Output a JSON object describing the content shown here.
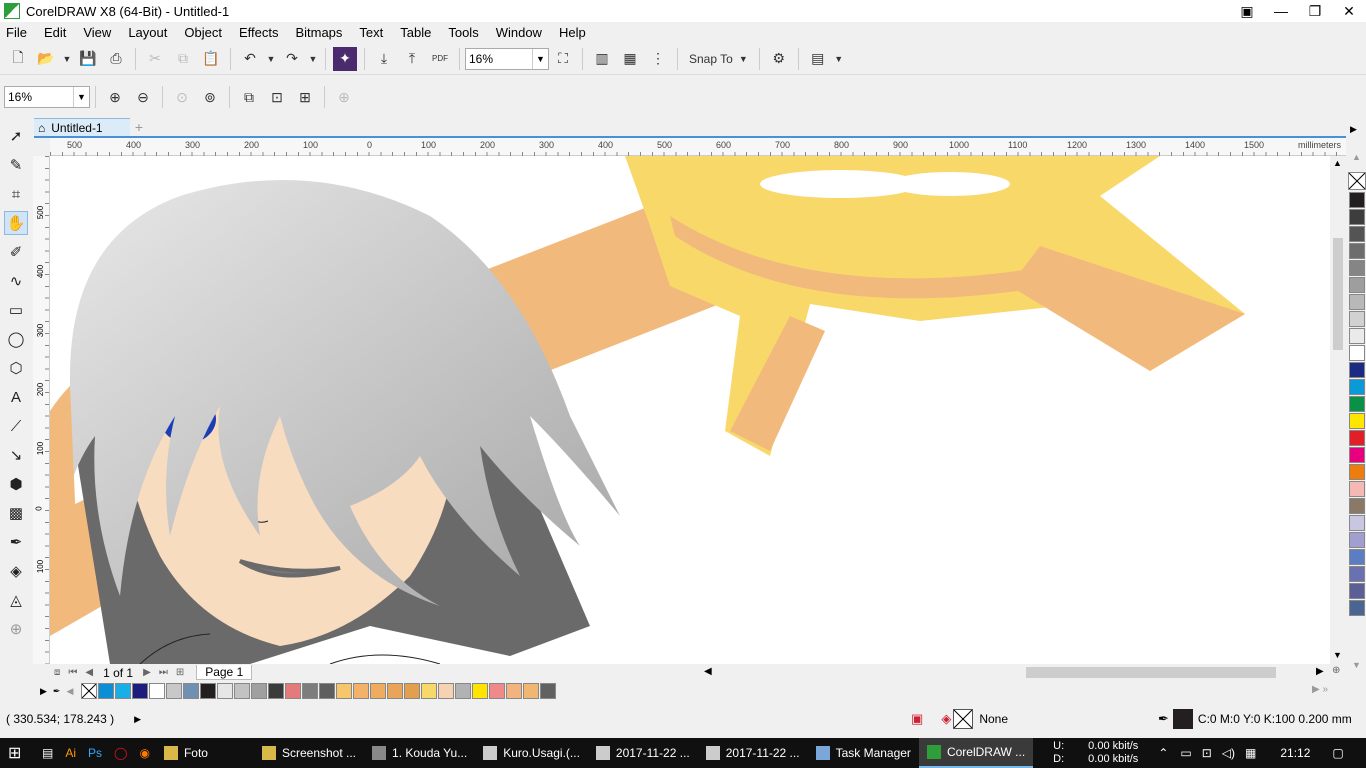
{
  "window": {
    "title": "CorelDRAW X8 (64-Bit) - Untitled-1"
  },
  "menu": [
    {
      "label": "File"
    },
    {
      "label": "Edit"
    },
    {
      "label": "View"
    },
    {
      "label": "Layout"
    },
    {
      "label": "Object"
    },
    {
      "label": "Effects"
    },
    {
      "label": "Bitmaps"
    },
    {
      "label": "Text"
    },
    {
      "label": "Table"
    },
    {
      "label": "Tools"
    },
    {
      "label": "Window"
    },
    {
      "label": "Help"
    }
  ],
  "toolbar": {
    "zoom_value": "16%",
    "snap_label": "Snap To",
    "pdf_label": "PDF"
  },
  "zoombar": {
    "zoom_value": "16%"
  },
  "document": {
    "tab_label": "Untitled-1",
    "page_tab": "Page 1",
    "page_count": "1 of 1"
  },
  "ruler": {
    "units": "millimeters",
    "h_ticks": [
      "500",
      "400",
      "300",
      "200",
      "100",
      "0",
      "100",
      "200",
      "300",
      "400",
      "500",
      "600",
      "700",
      "800",
      "900",
      "1000",
      "1100",
      "1200",
      "1300",
      "1400",
      "1500"
    ],
    "v_ticks": [
      "500",
      "400",
      "300",
      "200",
      "100",
      "0",
      "100"
    ]
  },
  "palette": {
    "horizontal": [
      "#0a8fd6",
      "#19aee6",
      "#1d1d7e",
      "#ffffff",
      "#c8c8c8",
      "#6f8fb3",
      "#231f20",
      "#e6e6e6",
      "#c2c2c2",
      "#a0a0a0",
      "#3b3b3b",
      "#e47a7a",
      "#7d7d7d",
      "#5e5e5e",
      "#f7c56b",
      "#f3b169",
      "#efac5f",
      "#e8a55a",
      "#e2a04e",
      "#f9d86a",
      "#f7d2b2",
      "#b2b2b2",
      "#ffe400",
      "#f08a8a",
      "#f2b37e",
      "#f1b770",
      "#616161"
    ],
    "vertical": [
      "#231f20",
      "#3d3d3d",
      "#545454",
      "#6d6d6d",
      "#858585",
      "#9e9e9e",
      "#b8b8b8",
      "#d1d1d1",
      "#eaeaea",
      "#ffffff",
      "#1c2a84",
      "#0b9ad8",
      "#0a9148",
      "#ffe600",
      "#e41e26",
      "#e6007e",
      "#ee7d10",
      "#f4b9b4",
      "#8c7867",
      "#c9c6e2",
      "#a19fd0",
      "#5b7dc1",
      "#6a71b1",
      "#5b5f96",
      "#4a6591"
    ]
  },
  "status": {
    "coords": "( 330.534; 178.243 )",
    "fill_label": "None",
    "outline": "C:0 M:0 Y:0 K:100  0.200 mm"
  },
  "taskbar": {
    "tasks": [
      {
        "label": "Foto"
      },
      {
        "label": "Screenshot ..."
      },
      {
        "label": "1. Kouda Yu..."
      },
      {
        "label": "Kuro.Usagi.(..."
      },
      {
        "label": "2017-11-22 ..."
      },
      {
        "label": "2017-11-22 ..."
      },
      {
        "label": "Task Manager"
      },
      {
        "label": "CorelDRAW ..."
      }
    ],
    "net_u_label": "U:",
    "net_d_label": "D:",
    "net_u": "0.00 kbit/s",
    "net_d": "0.00 kbit/s",
    "time": "21:12"
  },
  "colors": {
    "canvas": "#ffffff",
    "skin": "#f8dcc0",
    "hair_light": "#c8c8c8",
    "hair_dark": "#6a6a6a",
    "eye": "#1a3fb5",
    "star": "#f9d86a",
    "star_shadow": "#f2b97c"
  }
}
